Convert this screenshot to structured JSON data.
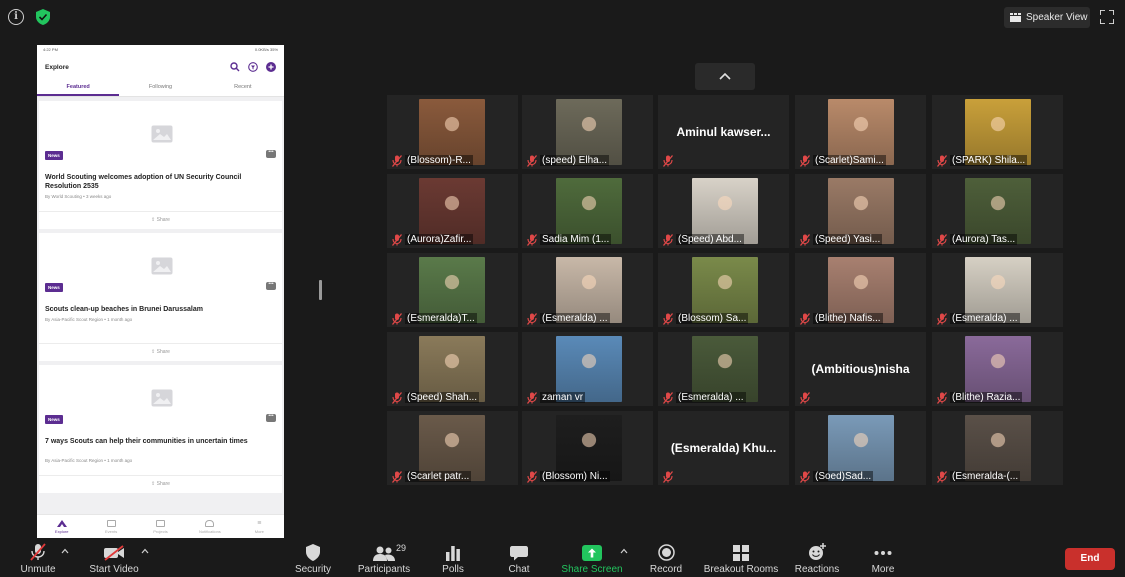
{
  "topbar": {
    "speaker_view_label": "Speaker View",
    "info_icon": "info-icon",
    "security_icon": "shield-check-icon",
    "fullscreen_icon": "fullscreen-icon"
  },
  "phone": {
    "status_left": "4:22 PM",
    "status_right": "0.0KB/s 35%",
    "title": "Explore",
    "tabs": [
      "Featured",
      "Following",
      "Recent"
    ],
    "cards": [
      {
        "badge": "News",
        "title": "World Scouting welcomes adoption of UN Security Council Resolution 2535",
        "meta": "By World Scouting  •  3 weeks ago",
        "share": "Share"
      },
      {
        "badge": "News",
        "title": "Scouts clean-up beaches in Brunei Darussalam",
        "meta": "By Asia-Pacific Scout Region  •  1 month ago",
        "share": "Share"
      },
      {
        "badge": "News",
        "title": "7 ways Scouts can help their communities in uncertain times",
        "meta": "By Asia-Pacific Scout Region  •  1 month ago",
        "share": "Share"
      }
    ],
    "nav": [
      "Explore",
      "Events",
      "Projects",
      "Notifications",
      "More"
    ],
    "accent": "#5c2d91"
  },
  "participants": [
    {
      "name": "(Blossom)-R...",
      "photo": "#8a5a3c"
    },
    {
      "name": "(speed) Elha...",
      "photo": "#6d6a5a"
    },
    {
      "name": "Aminul  kawser...",
      "photo": ""
    },
    {
      "name": "(Scarlet)Sami...",
      "photo": "#b98a6a"
    },
    {
      "name": "(SPARK) Shila...",
      "photo": "#c9a03a"
    },
    {
      "name": "(Aurora)Zafir...",
      "photo": "#6b3a33"
    },
    {
      "name": "Sadia Mim (1...",
      "photo": "#4f6b3c"
    },
    {
      "name": "(Speed) Abd...",
      "photo": "#d8d2c8"
    },
    {
      "name": "(Speed) Yasi...",
      "photo": "#9a7a66"
    },
    {
      "name": "(Aurora) Tas...",
      "photo": "#4e5f3a"
    },
    {
      "name": "(Esmeralda)T...",
      "photo": "#5a7a4a"
    },
    {
      "name": "(Esmeralda) ...",
      "photo": "#c8b8a8"
    },
    {
      "name": "(Blossom) Sa...",
      "photo": "#7a8a4a"
    },
    {
      "name": "(Blithe) Nafis...",
      "photo": "#a88070"
    },
    {
      "name": "(Esmeralda) ...",
      "photo": "#d6d0c4"
    },
    {
      "name": "(Speed) Shah...",
      "photo": "#8a7a5a"
    },
    {
      "name": "zaman vr",
      "photo": "#5a8ab8"
    },
    {
      "name": "(Esmeralda) ...",
      "photo": "#4a5a3a"
    },
    {
      "name": "(Ambitious)nisha",
      "photo": ""
    },
    {
      "name": "(Blithe) Razia...",
      "photo": "#8a6a9a"
    },
    {
      "name": "(Scarlet patr...",
      "photo": "#6a5a4a"
    },
    {
      "name": "(Blossom) Ni...",
      "photo": "#1e1e1e"
    },
    {
      "name": "(Esmeralda)  Khu...",
      "photo": ""
    },
    {
      "name": "(Soed)Sad...",
      "photo": "#7a9ab8"
    },
    {
      "name": "(Esmeralda-(...",
      "photo": "#5a5048"
    }
  ],
  "toolbar": {
    "unmute": "Unmute",
    "start_video": "Start Video",
    "security": "Security",
    "participants": "Participants",
    "participant_count": "29",
    "polls": "Polls",
    "chat": "Chat",
    "share_screen": "Share Screen",
    "record": "Record",
    "breakout_rooms": "Breakout Rooms",
    "reactions": "Reactions",
    "more": "More",
    "end": "End",
    "share_color": "#22c55e",
    "end_color": "#c9302c"
  }
}
